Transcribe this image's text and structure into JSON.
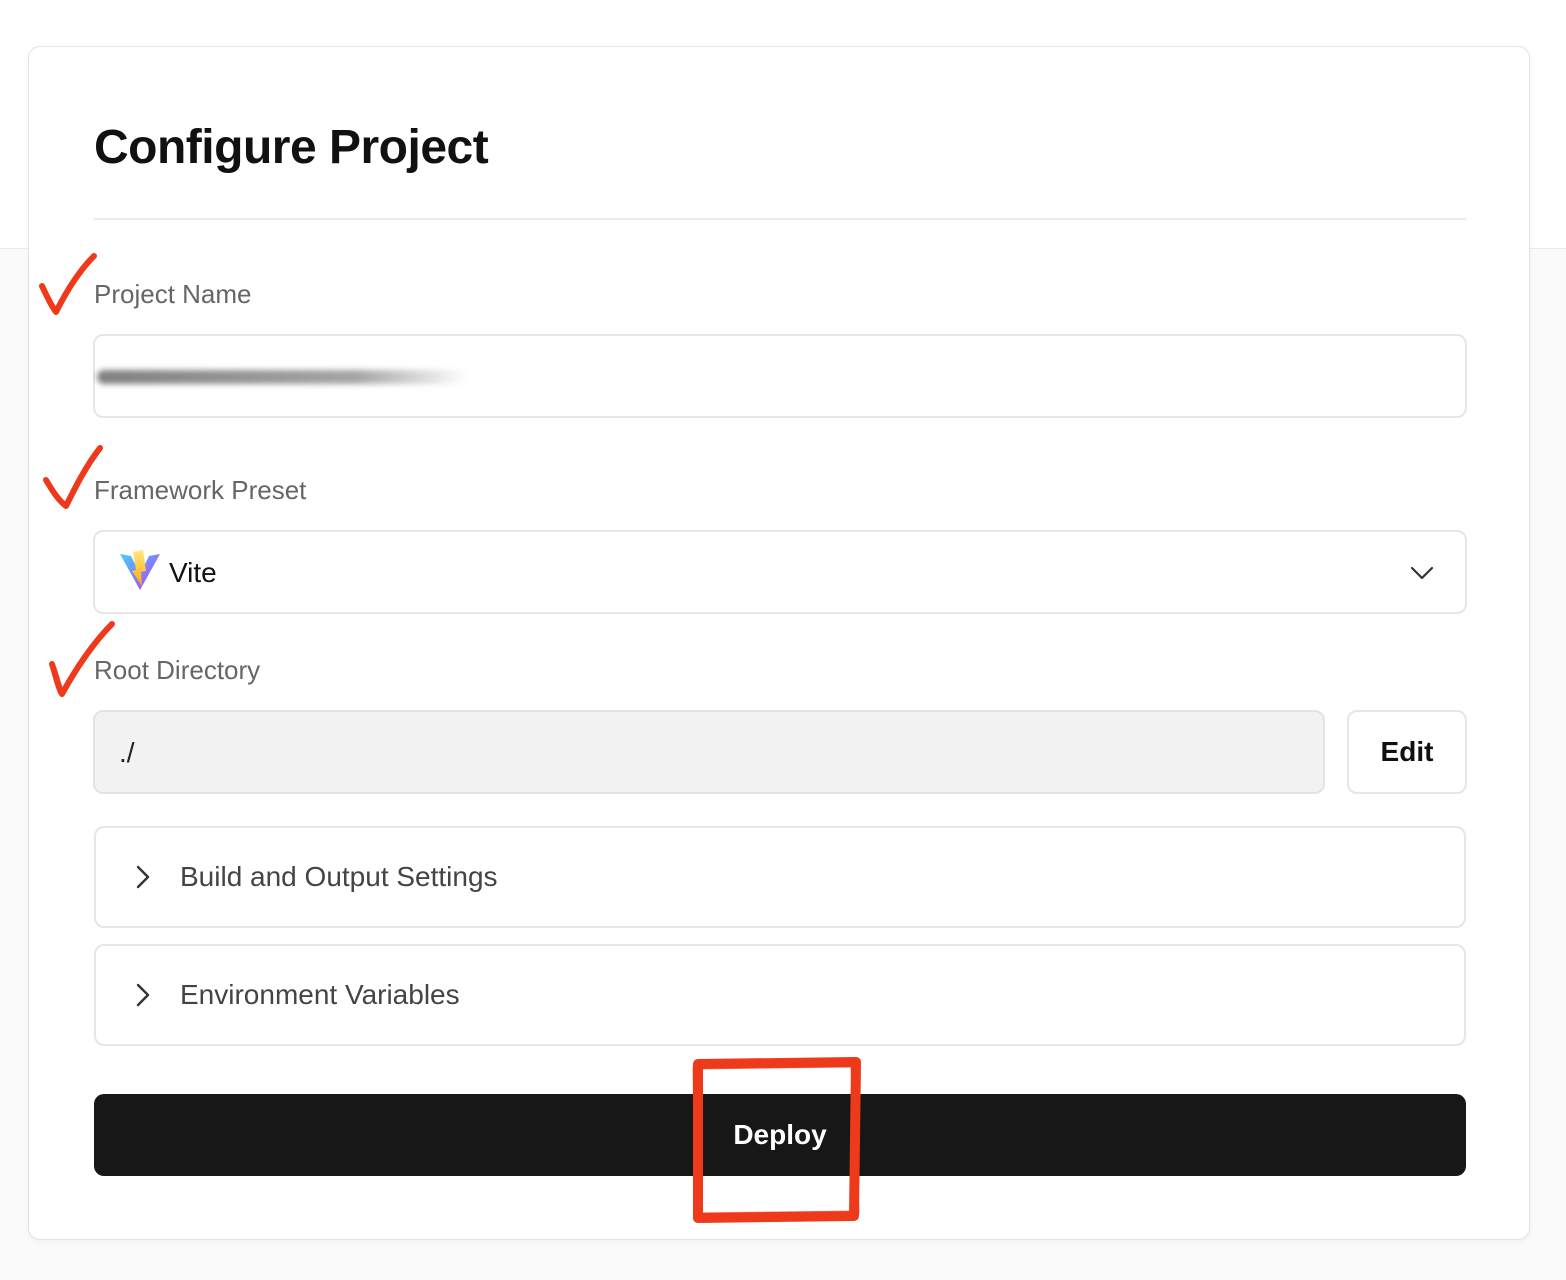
{
  "page": {
    "title": "Configure Project"
  },
  "form": {
    "project_name": {
      "label": "Project Name",
      "value": ""
    },
    "framework_preset": {
      "label": "Framework Preset",
      "value": "Vite",
      "icon": "vite-logo-icon"
    },
    "root_directory": {
      "label": "Root Directory",
      "value": "./",
      "edit_label": "Edit"
    }
  },
  "sections": [
    {
      "label": "Build and Output Settings",
      "expanded": false
    },
    {
      "label": "Environment Variables",
      "expanded": false
    }
  ],
  "actions": {
    "deploy_label": "Deploy"
  },
  "colors": {
    "deploy_bg": "#171717",
    "annotation": "#ee3a1b",
    "vite_purple": "#9a4dff",
    "vite_yellow": "#ffd028"
  }
}
